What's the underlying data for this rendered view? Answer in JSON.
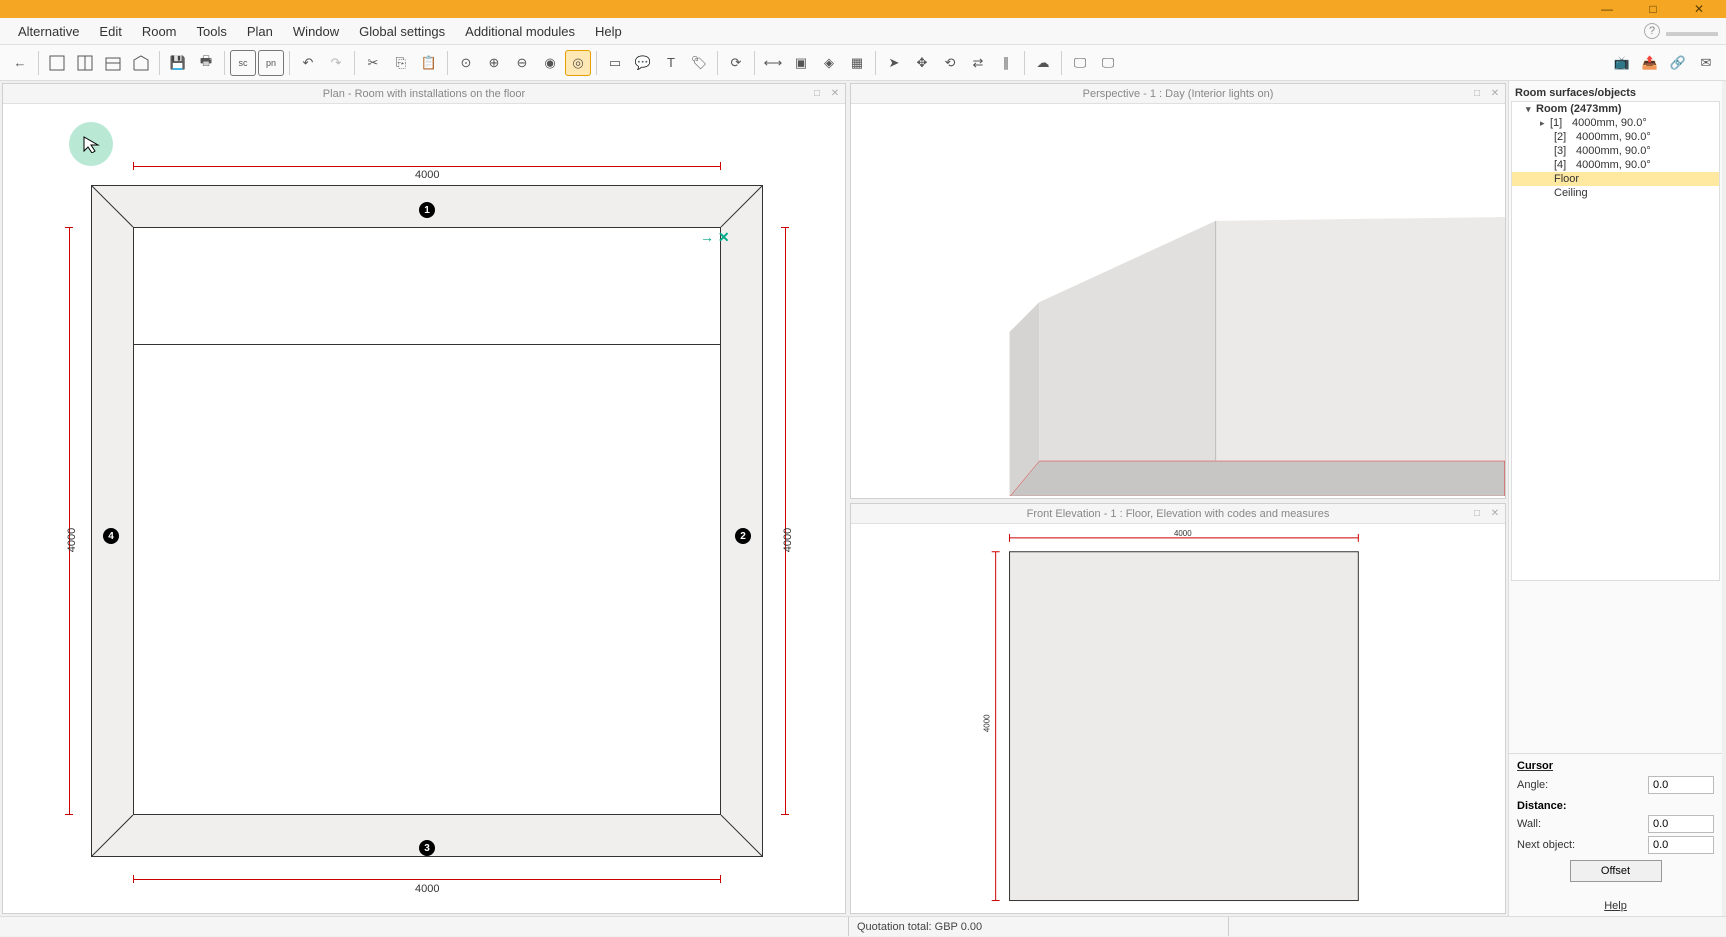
{
  "menubar": [
    "Alternative",
    "Edit",
    "Room",
    "Tools",
    "Plan",
    "Window",
    "Global settings",
    "Additional modules",
    "Help"
  ],
  "panes": {
    "plan_title": "Plan - Room with installations on the floor",
    "perspective_title": "Perspective - 1 : Day (Interior lights on)",
    "elevation_title": "Front Elevation - 1 : Floor, Elevation with codes and measures"
  },
  "plan": {
    "dim_top": "4000",
    "dim_bottom": "4000",
    "dim_left": "4000",
    "dim_right": "4000",
    "walls": [
      "1",
      "2",
      "3",
      "4"
    ]
  },
  "elev": {
    "dim_top": "4000",
    "dim_left": "4000"
  },
  "tree": {
    "title": "Room surfaces/objects",
    "root": "Room (2473mm)",
    "walls": [
      {
        "id": "[1]",
        "v": "4000mm, 90.0°"
      },
      {
        "id": "[2]",
        "v": "4000mm, 90.0°"
      },
      {
        "id": "[3]",
        "v": "4000mm, 90.0°"
      },
      {
        "id": "[4]",
        "v": "4000mm, 90.0°"
      }
    ],
    "floor": "Floor",
    "ceiling": "Ceiling"
  },
  "props": {
    "cursor_h": "Cursor",
    "angle_l": "Angle:",
    "angle_v": "0.0",
    "dist_h": "Distance:",
    "wall_l": "Wall:",
    "wall_v": "0.0",
    "next_l": "Next object:",
    "next_v": "0.0",
    "offset": "Offset"
  },
  "help": "Help",
  "status": {
    "quote": "Quotation total: GBP 0.00"
  }
}
